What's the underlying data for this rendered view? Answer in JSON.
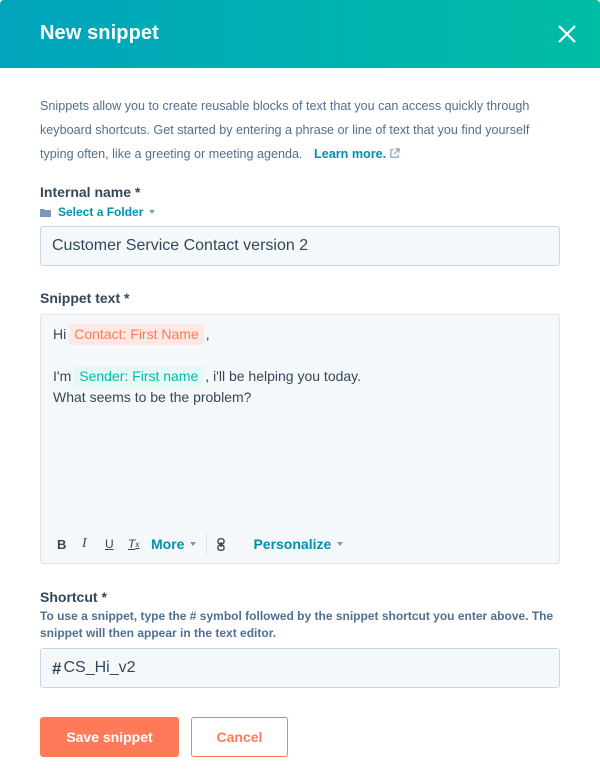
{
  "dialog": {
    "title": "New snippet",
    "close_icon": "close-x-icon",
    "header_gradient": [
      "#00a4bd",
      "#00bda5"
    ]
  },
  "description": {
    "text": "Snippets allow you to create reusable blocks of text that you can access quickly through keyboard shortcuts. Get started by entering a phrase or line of text that you find yourself typing often, like a greeting or meeting agenda.",
    "link_label": "Learn more.",
    "link_icon": "external-link-icon"
  },
  "internal_name": {
    "label": "Internal name *",
    "folder_label": "Select a Folder",
    "folder_icon": "folder-icon",
    "value": "Customer Service Contact version 2"
  },
  "snippet_text": {
    "label": "Snippet text *",
    "lines": [
      {
        "before": "Hi",
        "token": "Contact: First Name",
        "after": ","
      },
      {
        "before": "I'm",
        "token": "Sender: First name",
        "after": ", i'll be helping you today."
      },
      {
        "text": "What seems to be the problem?"
      }
    ],
    "toolbar": {
      "bold": "B",
      "italic": "I",
      "underline": "U",
      "clear_format": "T",
      "clear_format_sub": "x",
      "more": "More",
      "link_icon": "link-icon",
      "personalize": "Personalize"
    }
  },
  "shortcut": {
    "label": "Shortcut *",
    "hint": "To use a snippet, type the # symbol followed by the snippet shortcut you enter above. The snippet will then appear in the text editor.",
    "prefix": "#",
    "value": "CS_Hi_v2"
  },
  "actions": {
    "save": "Save snippet",
    "cancel": "Cancel"
  },
  "colors": {
    "accent": "#ff7a59",
    "link": "#0091ae",
    "contact_token": "#ff7a59",
    "sender_token": "#00bda5"
  }
}
